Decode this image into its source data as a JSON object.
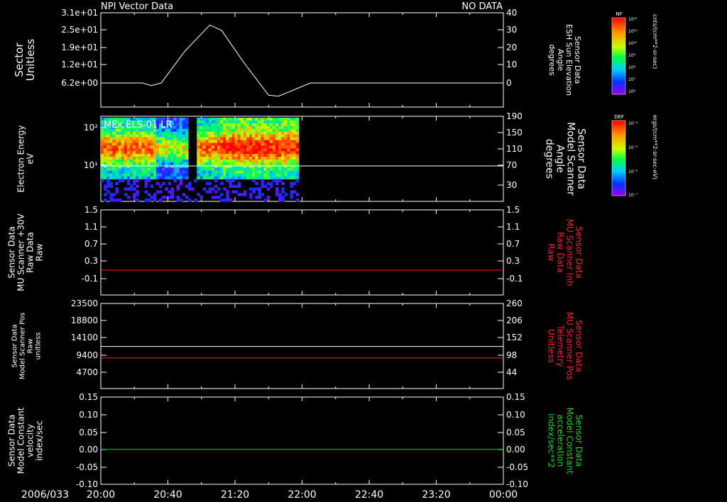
{
  "header": {
    "title": "NPI Vector Data",
    "status": "NO DATA"
  },
  "footer": {
    "date": "2006/033"
  },
  "time_axis": {
    "labels": [
      "20:00",
      "20:40",
      "21:20",
      "22:00",
      "22:40",
      "23:20",
      "00:00"
    ]
  },
  "colors": {
    "white": "#ffffff",
    "red": "#ff2020",
    "green": "#20d020"
  },
  "colorbars": [
    {
      "label": "NF",
      "unit": "cnts/(cm**2-sr-sec)",
      "ticks": [
        "10¹²",
        "10¹¹",
        "10¹⁰",
        "10⁹",
        "10⁸",
        "10⁷",
        "10⁶"
      ]
    },
    {
      "label": "DEF",
      "unit": "ergs/(cm**2-sr-sec-eV)",
      "ticks": [
        "10⁻⁴",
        "10⁻⁵",
        "10⁻⁶",
        "10⁻⁷"
      ]
    }
  ],
  "chart_data": [
    {
      "type": "line",
      "id": "panel1",
      "left_label": [
        "Sector",
        "Unitless"
      ],
      "left_ticks": [
        "3.1e+01",
        "2.5e+01",
        "1.9e+01",
        "1.2e+01",
        "6.2e+00"
      ],
      "right_label": [
        "Sensor Data",
        "ESH Sun Elevation",
        "Angle",
        "degrees"
      ],
      "right_ticks": [
        "40",
        "30",
        "20",
        "10",
        "0"
      ],
      "ylim": [
        -10,
        40
      ],
      "series": [
        {
          "color": "white",
          "x": [
            "20:00",
            "20:25",
            "20:30",
            "20:36",
            "20:50",
            "21:05",
            "21:12",
            "21:25",
            "21:40",
            "21:46",
            "21:55",
            "22:05",
            "00:00"
          ],
          "y": [
            0,
            0,
            -1.5,
            0,
            18,
            33,
            30,
            12,
            -7,
            -7.5,
            -4,
            0,
            0
          ]
        }
      ]
    },
    {
      "type": "heatmap",
      "id": "panel2",
      "title": "MEx ELS-01 LR",
      "left_label": [
        "Electron Energy",
        "eV"
      ],
      "left_ticks": [
        "10²",
        "10¹"
      ],
      "right_label": [
        "Sensor Data",
        "Model Scanner",
        "Angle",
        "degrees"
      ],
      "right_ticks": [
        "190",
        "150",
        "110",
        "70",
        "30"
      ],
      "data_end": "21:58",
      "line_value": 85
    },
    {
      "type": "line",
      "id": "panel3",
      "left_label": [
        "Sensor Data",
        "MU Scanner +30V",
        "Raw Data",
        "Raw"
      ],
      "left_ticks": [
        "1.5",
        "1.1",
        "0.7",
        "0.3",
        "-0.1"
      ],
      "right_label": [
        "Sensor Data",
        "MU Scanner Inh",
        "Raw Data",
        "Raw"
      ],
      "right_ticks": [
        "1.5",
        "1.1",
        "0.7",
        "0.3",
        "-0.1"
      ],
      "right_color": "red",
      "series": [
        {
          "color": "red",
          "value": 0.0
        }
      ]
    },
    {
      "type": "line",
      "id": "panel4",
      "left_label": [
        "Sensor Data",
        "Model Scanner Pos",
        "Raw",
        "unitless"
      ],
      "left_ticks": [
        "23500",
        "18800",
        "14100",
        "9400",
        "4700"
      ],
      "right_label": [
        "Sensor Data",
        "MU Scanner Pos",
        "Telemetry",
        "Unitless"
      ],
      "right_ticks": [
        "260",
        "206",
        "152",
        "98",
        "44"
      ],
      "right_color": "red",
      "series": [
        {
          "color": "white",
          "value": 11750
        },
        {
          "color": "red",
          "value": 8600
        }
      ]
    },
    {
      "type": "line",
      "id": "panel5",
      "left_label": [
        "Sensor Data",
        "Model Constant",
        "velocity",
        "index/sec"
      ],
      "left_ticks": [
        "0.15",
        "0.10",
        "0.05",
        "0.00",
        "-0.05",
        "-0.10"
      ],
      "right_label": [
        "Sensor Data",
        "Model Constant",
        "acceleration",
        "index/sec**2"
      ],
      "right_ticks": [
        "0.15",
        "0.10",
        "0.05",
        "0.00",
        "-0.05",
        "-0.10"
      ],
      "right_color": "green",
      "series": [
        {
          "color": "green",
          "value": 0.0
        }
      ]
    }
  ]
}
